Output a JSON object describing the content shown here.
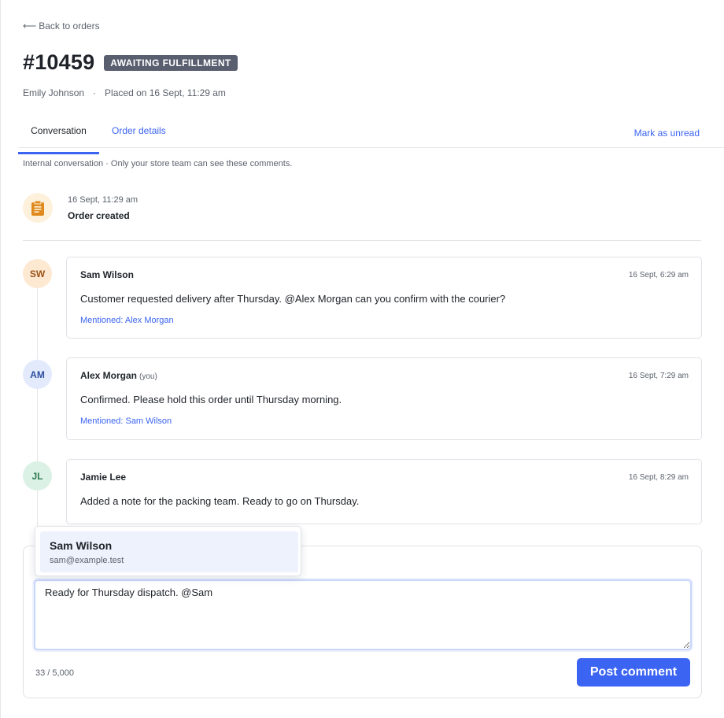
{
  "nav": {
    "back_label": "Back to orders"
  },
  "order": {
    "number": "#10459",
    "status": "AWAITING FULFILLMENT",
    "customer": "Emily Johnson",
    "separator": "·",
    "placed": "Placed on 16 Sept, 11:29 am"
  },
  "tabs": {
    "conversation": "Conversation",
    "order_details": "Order details",
    "mark_unread": "Mark as unread"
  },
  "note": "Internal conversation · Only your store team can see these comments.",
  "event": {
    "time": "16 Sept, 11:29 am",
    "title": "Order created",
    "icon": "clipboard-icon",
    "icon_color": "#e08a1e"
  },
  "comments": [
    {
      "initials": "SW",
      "author": "Sam Wilson",
      "you": "",
      "time": "16 Sept, 6:29 am",
      "body": "Customer requested delivery after Thursday. @Alex Morgan can you confirm with the courier?",
      "mention": "Mentioned: Alex Morgan"
    },
    {
      "initials": "AM",
      "author": "Alex Morgan",
      "you": "(you)",
      "time": "16 Sept, 7:29 am",
      "body": "Confirmed. Please hold this order until Thursday morning.",
      "mention": "Mentioned: Sam Wilson"
    },
    {
      "initials": "JL",
      "author": "Jamie Lee",
      "you": "",
      "time": "16 Sept, 8:29 am",
      "body": "Added a note for the packing team. Ready to go on Thursday.",
      "mention": ""
    }
  ],
  "compose": {
    "value": "Ready for Thursday dispatch. @Sam",
    "counter": "33 / 5,000",
    "post_label": "Post comment"
  },
  "mention_popup": {
    "name": "Sam Wilson",
    "email": "sam@example.test"
  },
  "colors": {
    "accent": "#3b64f2",
    "badge": "#5a5f70"
  }
}
